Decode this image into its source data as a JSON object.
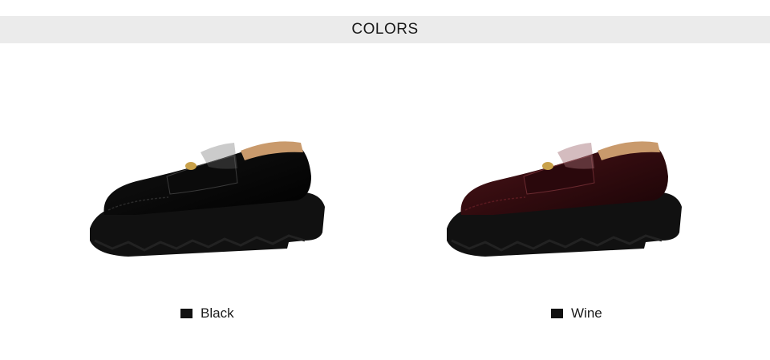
{
  "header": {
    "title": "COLORS"
  },
  "variants": [
    {
      "name": "Black",
      "swatch_color": "#111111",
      "upper_color": "#0d0d0d",
      "highlight_color": "#6a6a6a",
      "icon": "black-loafer-image"
    },
    {
      "name": "Wine",
      "swatch_color": "#111111",
      "upper_color": "#3a0e12",
      "highlight_color": "#a06a70",
      "icon": "wine-loafer-image"
    }
  ],
  "colors": {
    "header_background": "#ebebeb",
    "sole": "#111111",
    "lining": "#c99a6c",
    "buckle": "#c9a14a"
  }
}
